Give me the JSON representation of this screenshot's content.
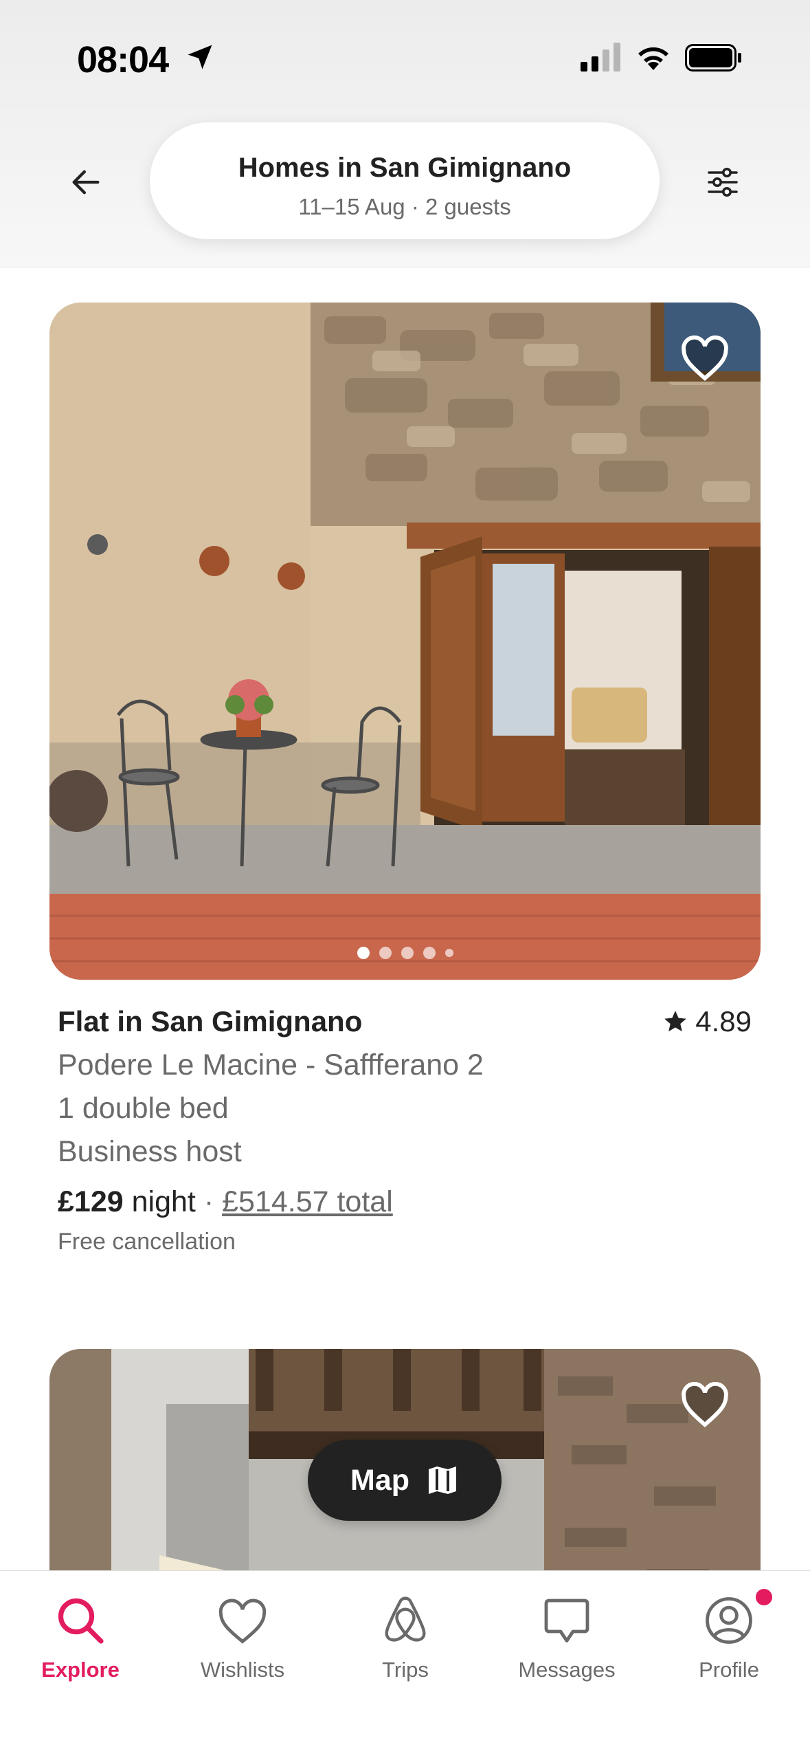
{
  "status_bar": {
    "time": "08:04"
  },
  "header": {
    "title": "Homes in San Gimignano",
    "subtitle": "11–15 Aug · 2 guests"
  },
  "listing": {
    "title": "Flat in San Gimignano",
    "rating": "4.89",
    "name": "Podere Le Macine - Saffferano 2",
    "beds": "1 double bed",
    "host_type": "Business host",
    "price": "£129",
    "price_unit": " night",
    "separator": " · ",
    "total": "£514.57 total",
    "cancellation": "Free cancellation",
    "photo_count": 5,
    "photo_index": 0
  },
  "map_button": {
    "label": "Map"
  },
  "tabs": [
    {
      "label": "Explore",
      "active": true
    },
    {
      "label": "Wishlists"
    },
    {
      "label": "Trips"
    },
    {
      "label": "Messages"
    },
    {
      "label": "Profile",
      "badge": true
    }
  ],
  "colors": {
    "accent": "#e31c5f",
    "text": "#222222",
    "muted": "#6a6a6a"
  }
}
